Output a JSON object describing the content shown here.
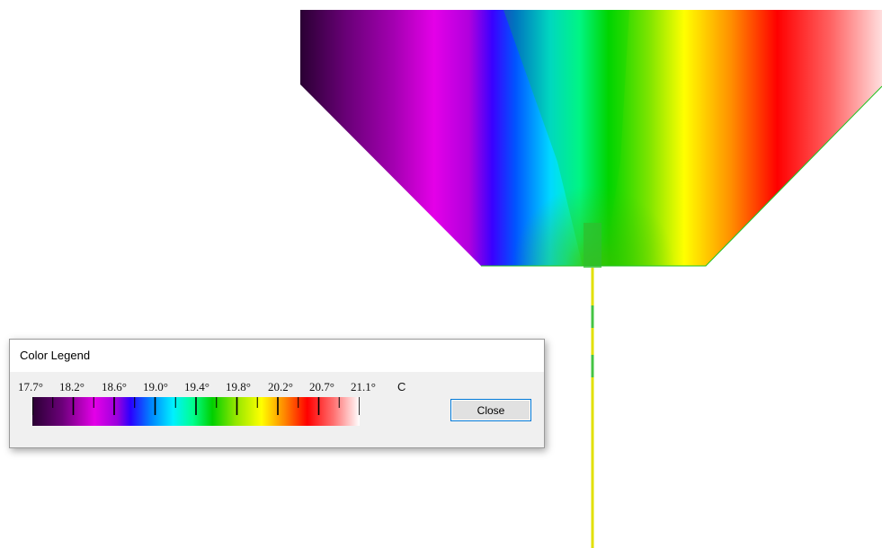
{
  "legend_dialog": {
    "title": "Color Legend",
    "tick_labels": [
      "17.7°",
      "18.2°",
      "18.6°",
      "19.0°",
      "19.4°",
      "19.8°",
      "20.2°",
      "20.7°",
      "21.1°"
    ],
    "unit": "C",
    "close_label": "Close"
  },
  "colors": {
    "gradient": [
      "#2a0033",
      "#6a0078",
      "#a300b0",
      "#e400e8",
      "#b100dd",
      "#1a00ff",
      "#0079ff",
      "#00e5ff",
      "#00ff9a",
      "#00d200",
      "#7fe500",
      "#ffff00",
      "#ff9500",
      "#ff0000",
      "#ff6a6a",
      "#ffffff"
    ],
    "outline": "#22c322",
    "probe_line": "#e5e500"
  }
}
